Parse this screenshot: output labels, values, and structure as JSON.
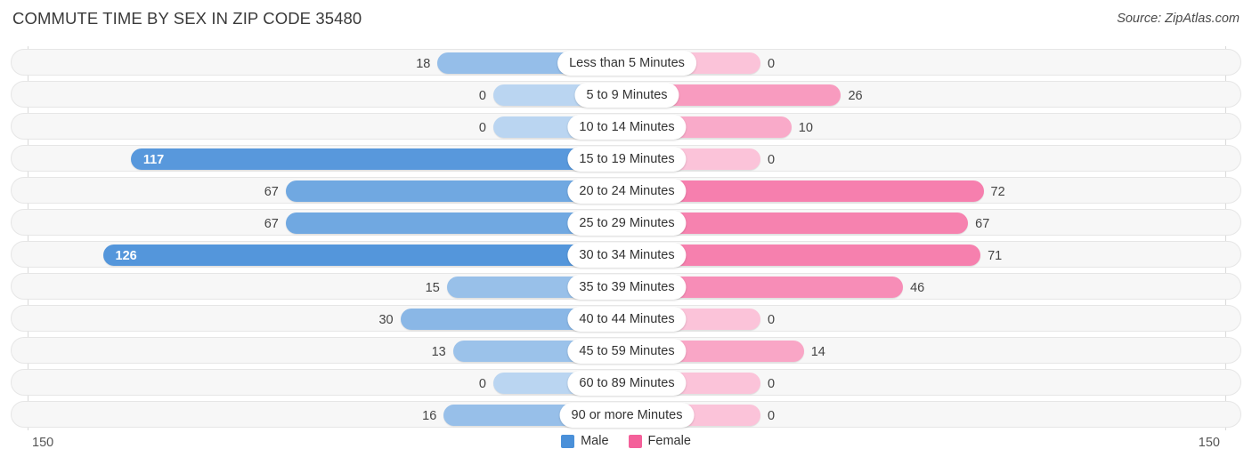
{
  "title": "COMMUTE TIME BY SEX IN ZIP CODE 35480",
  "source": "Source: ZipAtlas.com",
  "legend": {
    "male": {
      "label": "Male",
      "color": "#4a90d9"
    },
    "female": {
      "label": "Female",
      "color": "#f4609a"
    }
  },
  "axis": {
    "left_max": "150",
    "right_max": "150"
  },
  "chart_data": {
    "type": "bar",
    "title": "COMMUTE TIME BY SEX IN ZIP CODE 35480",
    "subtitle": "Source: ZipAtlas.com",
    "orientation": "horizontal-diverging",
    "xlabel": "",
    "ylabel": "",
    "xlim": [
      150,
      150
    ],
    "grid": false,
    "legend_position": "bottom-center",
    "categories": [
      "Less than 5 Minutes",
      "5 to 9 Minutes",
      "10 to 14 Minutes",
      "15 to 19 Minutes",
      "20 to 24 Minutes",
      "25 to 29 Minutes",
      "30 to 34 Minutes",
      "35 to 39 Minutes",
      "40 to 44 Minutes",
      "45 to 59 Minutes",
      "60 to 89 Minutes",
      "90 or more Minutes"
    ],
    "series": [
      {
        "name": "Male",
        "color": "#4a90d9",
        "values": [
          18,
          0,
          0,
          117,
          67,
          67,
          126,
          15,
          30,
          13,
          0,
          16
        ]
      },
      {
        "name": "Female",
        "color": "#f4609a",
        "values": [
          0,
          26,
          10,
          0,
          72,
          67,
          71,
          46,
          0,
          14,
          0,
          0
        ]
      }
    ],
    "rows": [
      {
        "label": "Less than 5 Minutes",
        "male": 18,
        "female": 0,
        "male_text": "18",
        "female_text": "0"
      },
      {
        "label": "5 to 9 Minutes",
        "male": 0,
        "female": 26,
        "male_text": "0",
        "female_text": "26"
      },
      {
        "label": "10 to 14 Minutes",
        "male": 0,
        "female": 10,
        "male_text": "0",
        "female_text": "10"
      },
      {
        "label": "15 to 19 Minutes",
        "male": 117,
        "female": 0,
        "male_text": "117",
        "female_text": "0"
      },
      {
        "label": "20 to 24 Minutes",
        "male": 67,
        "female": 72,
        "male_text": "67",
        "female_text": "72"
      },
      {
        "label": "25 to 29 Minutes",
        "male": 67,
        "female": 67,
        "male_text": "67",
        "female_text": "67"
      },
      {
        "label": "30 to 34 Minutes",
        "male": 126,
        "female": 71,
        "male_text": "126",
        "female_text": "71"
      },
      {
        "label": "35 to 39 Minutes",
        "male": 15,
        "female": 46,
        "male_text": "15",
        "female_text": "46"
      },
      {
        "label": "40 to 44 Minutes",
        "male": 30,
        "female": 0,
        "male_text": "30",
        "female_text": "0"
      },
      {
        "label": "45 to 59 Minutes",
        "male": 13,
        "female": 14,
        "male_text": "13",
        "female_text": "14"
      },
      {
        "label": "60 to 89 Minutes",
        "male": 0,
        "female": 0,
        "male_text": "0",
        "female_text": "0"
      },
      {
        "label": "90 or more Minutes",
        "male": 16,
        "female": 0,
        "male_text": "16",
        "female_text": "0"
      }
    ]
  }
}
